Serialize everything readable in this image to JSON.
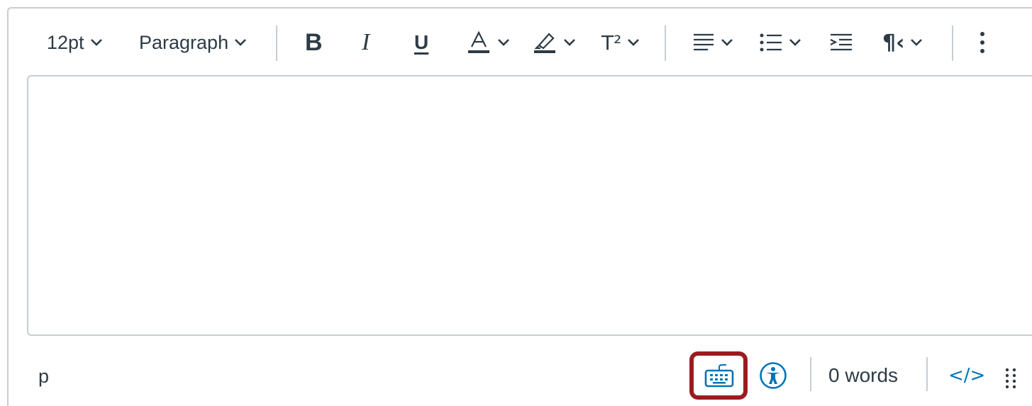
{
  "toolbar": {
    "font_size": "12pt",
    "block_format": "Paragraph",
    "bold_label": "B",
    "italic_label": "I",
    "underline_label": "U",
    "superscript_label": "T²"
  },
  "status": {
    "element_path": "p",
    "word_count": "0 words",
    "html_toggle": "</>"
  },
  "colors": {
    "icon": "#2d3b45",
    "border": "#c7cdd1",
    "accent": "#0374b5",
    "highlight": "#9b1c1f"
  },
  "icons": [
    "chevron-down-icon",
    "text-color-icon",
    "highlight-color-icon",
    "align-icon",
    "list-icon",
    "indent-icon",
    "paragraph-direction-icon",
    "more-vertical-icon",
    "keyboard-icon",
    "accessibility-icon",
    "resize-grip-icon"
  ]
}
